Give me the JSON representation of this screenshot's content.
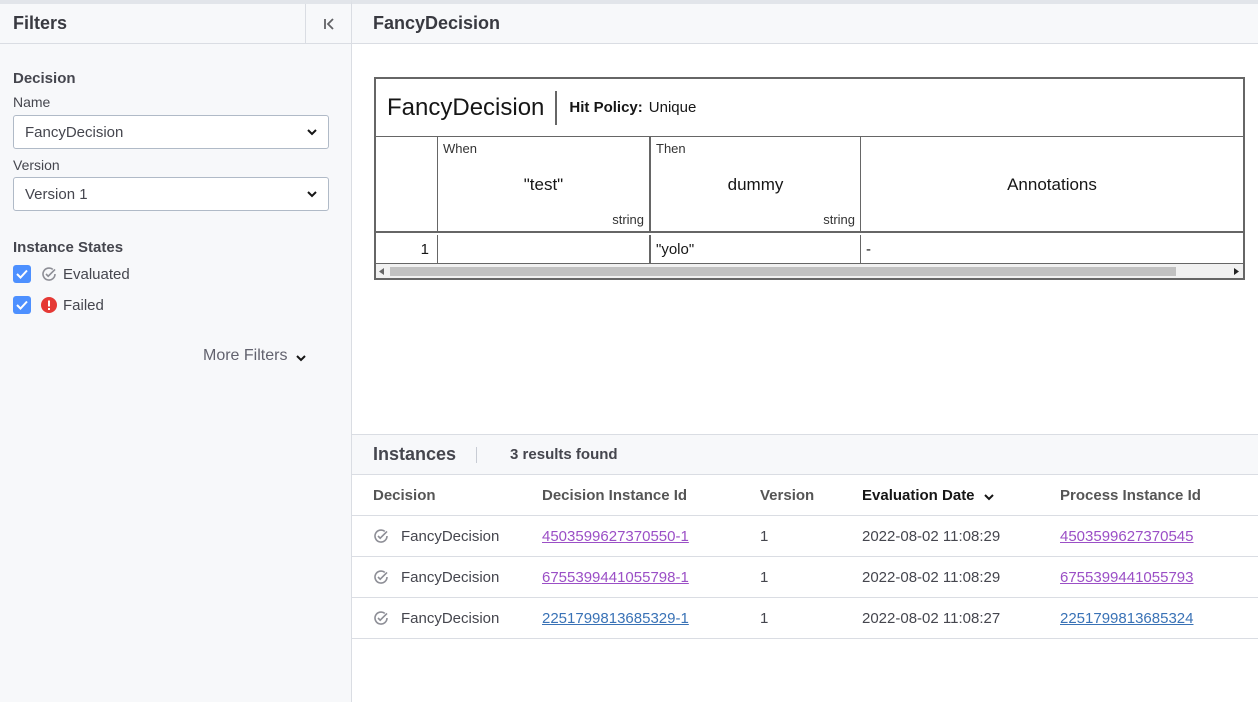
{
  "sidebar": {
    "title": "Filters",
    "decision_section": "Decision",
    "name_label": "Name",
    "name_value": "FancyDecision",
    "version_label": "Version",
    "version_value": "Version 1",
    "states_section": "Instance States",
    "states": [
      {
        "label": "Evaluated",
        "checked": true
      },
      {
        "label": "Failed",
        "checked": true
      }
    ],
    "more_filters": "More Filters"
  },
  "main": {
    "title": "FancyDecision"
  },
  "dmn": {
    "name": "FancyDecision",
    "hit_policy_label": "Hit Policy:",
    "hit_policy_value": "Unique",
    "input": {
      "kind": "When",
      "expression": "\"test\"",
      "type": "string"
    },
    "output": {
      "kind": "Then",
      "name": "dummy",
      "type": "string"
    },
    "annotations_label": "Annotations",
    "rules": [
      {
        "index": "1",
        "input": "",
        "output": "\"yolo\"",
        "annotation": "-"
      }
    ]
  },
  "instances": {
    "title": "Instances",
    "count": "3 results found",
    "columns": [
      "Decision",
      "Decision Instance Id",
      "Version",
      "Evaluation Date",
      "Process Instance Id"
    ],
    "rows": [
      {
        "decision": "FancyDecision",
        "decision_instance_id": "4503599627370550-1",
        "version": "1",
        "evaluation_date": "2022-08-02 11:08:29",
        "process_instance_id": "4503599627370545"
      },
      {
        "decision": "FancyDecision",
        "decision_instance_id": "6755399441055798-1",
        "version": "1",
        "evaluation_date": "2022-08-02 11:08:29",
        "process_instance_id": "6755399441055793"
      },
      {
        "decision": "FancyDecision",
        "decision_instance_id": "2251799813685329-1",
        "version": "1",
        "evaluation_date": "2022-08-02 11:08:27",
        "process_instance_id": "2251799813685324"
      }
    ]
  },
  "colors": {
    "checkbox": "#4d90ff",
    "failed": "#e53935",
    "link_visited": "#9b4fc6",
    "link": "#3972b6"
  }
}
